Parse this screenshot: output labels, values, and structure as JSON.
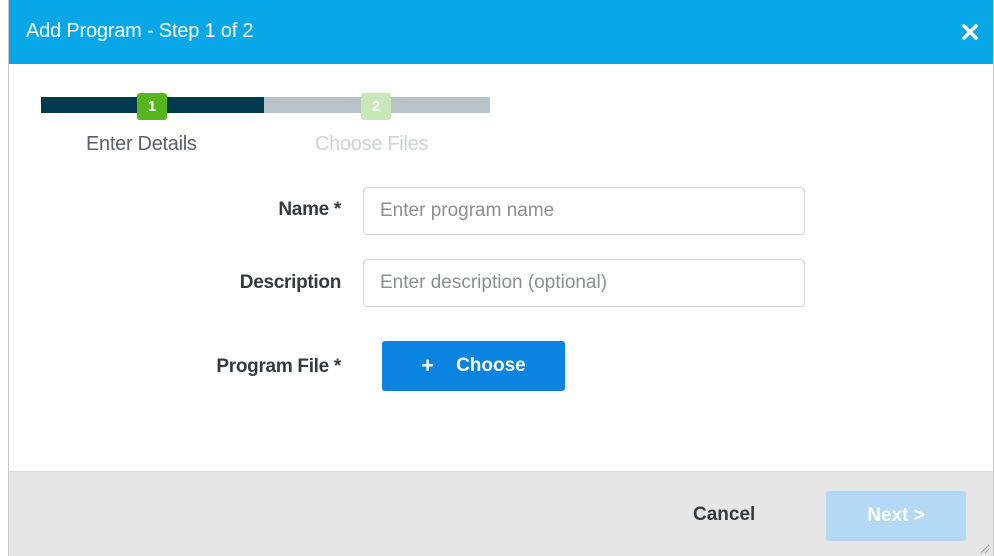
{
  "dialog": {
    "title": "Add Program - Step 1 of 2",
    "close_icon": "close-icon"
  },
  "stepper": {
    "steps": [
      {
        "number": "1",
        "label": "Enter Details",
        "state": "active"
      },
      {
        "number": "2",
        "label": "Choose Files",
        "state": "inactive"
      }
    ],
    "progress_fraction": 0.5
  },
  "form": {
    "name": {
      "label": "Name *",
      "placeholder": "Enter program name",
      "value": ""
    },
    "description": {
      "label": "Description",
      "placeholder": "Enter description (optional)",
      "value": ""
    },
    "program_file": {
      "label": "Program File *",
      "button_label": "Choose",
      "button_icon": "plus-icon"
    }
  },
  "footer": {
    "cancel_label": "Cancel",
    "next_label": "Next >",
    "next_enabled": false
  },
  "colors": {
    "header": "#07a7e8",
    "step_active": "#56b51c",
    "step_inactive": "#c9e8b8",
    "track_done": "#003a4e",
    "track_todo": "#b9c4ca",
    "primary_button": "#0a84e0",
    "disabled_button": "#b3d9f4"
  }
}
